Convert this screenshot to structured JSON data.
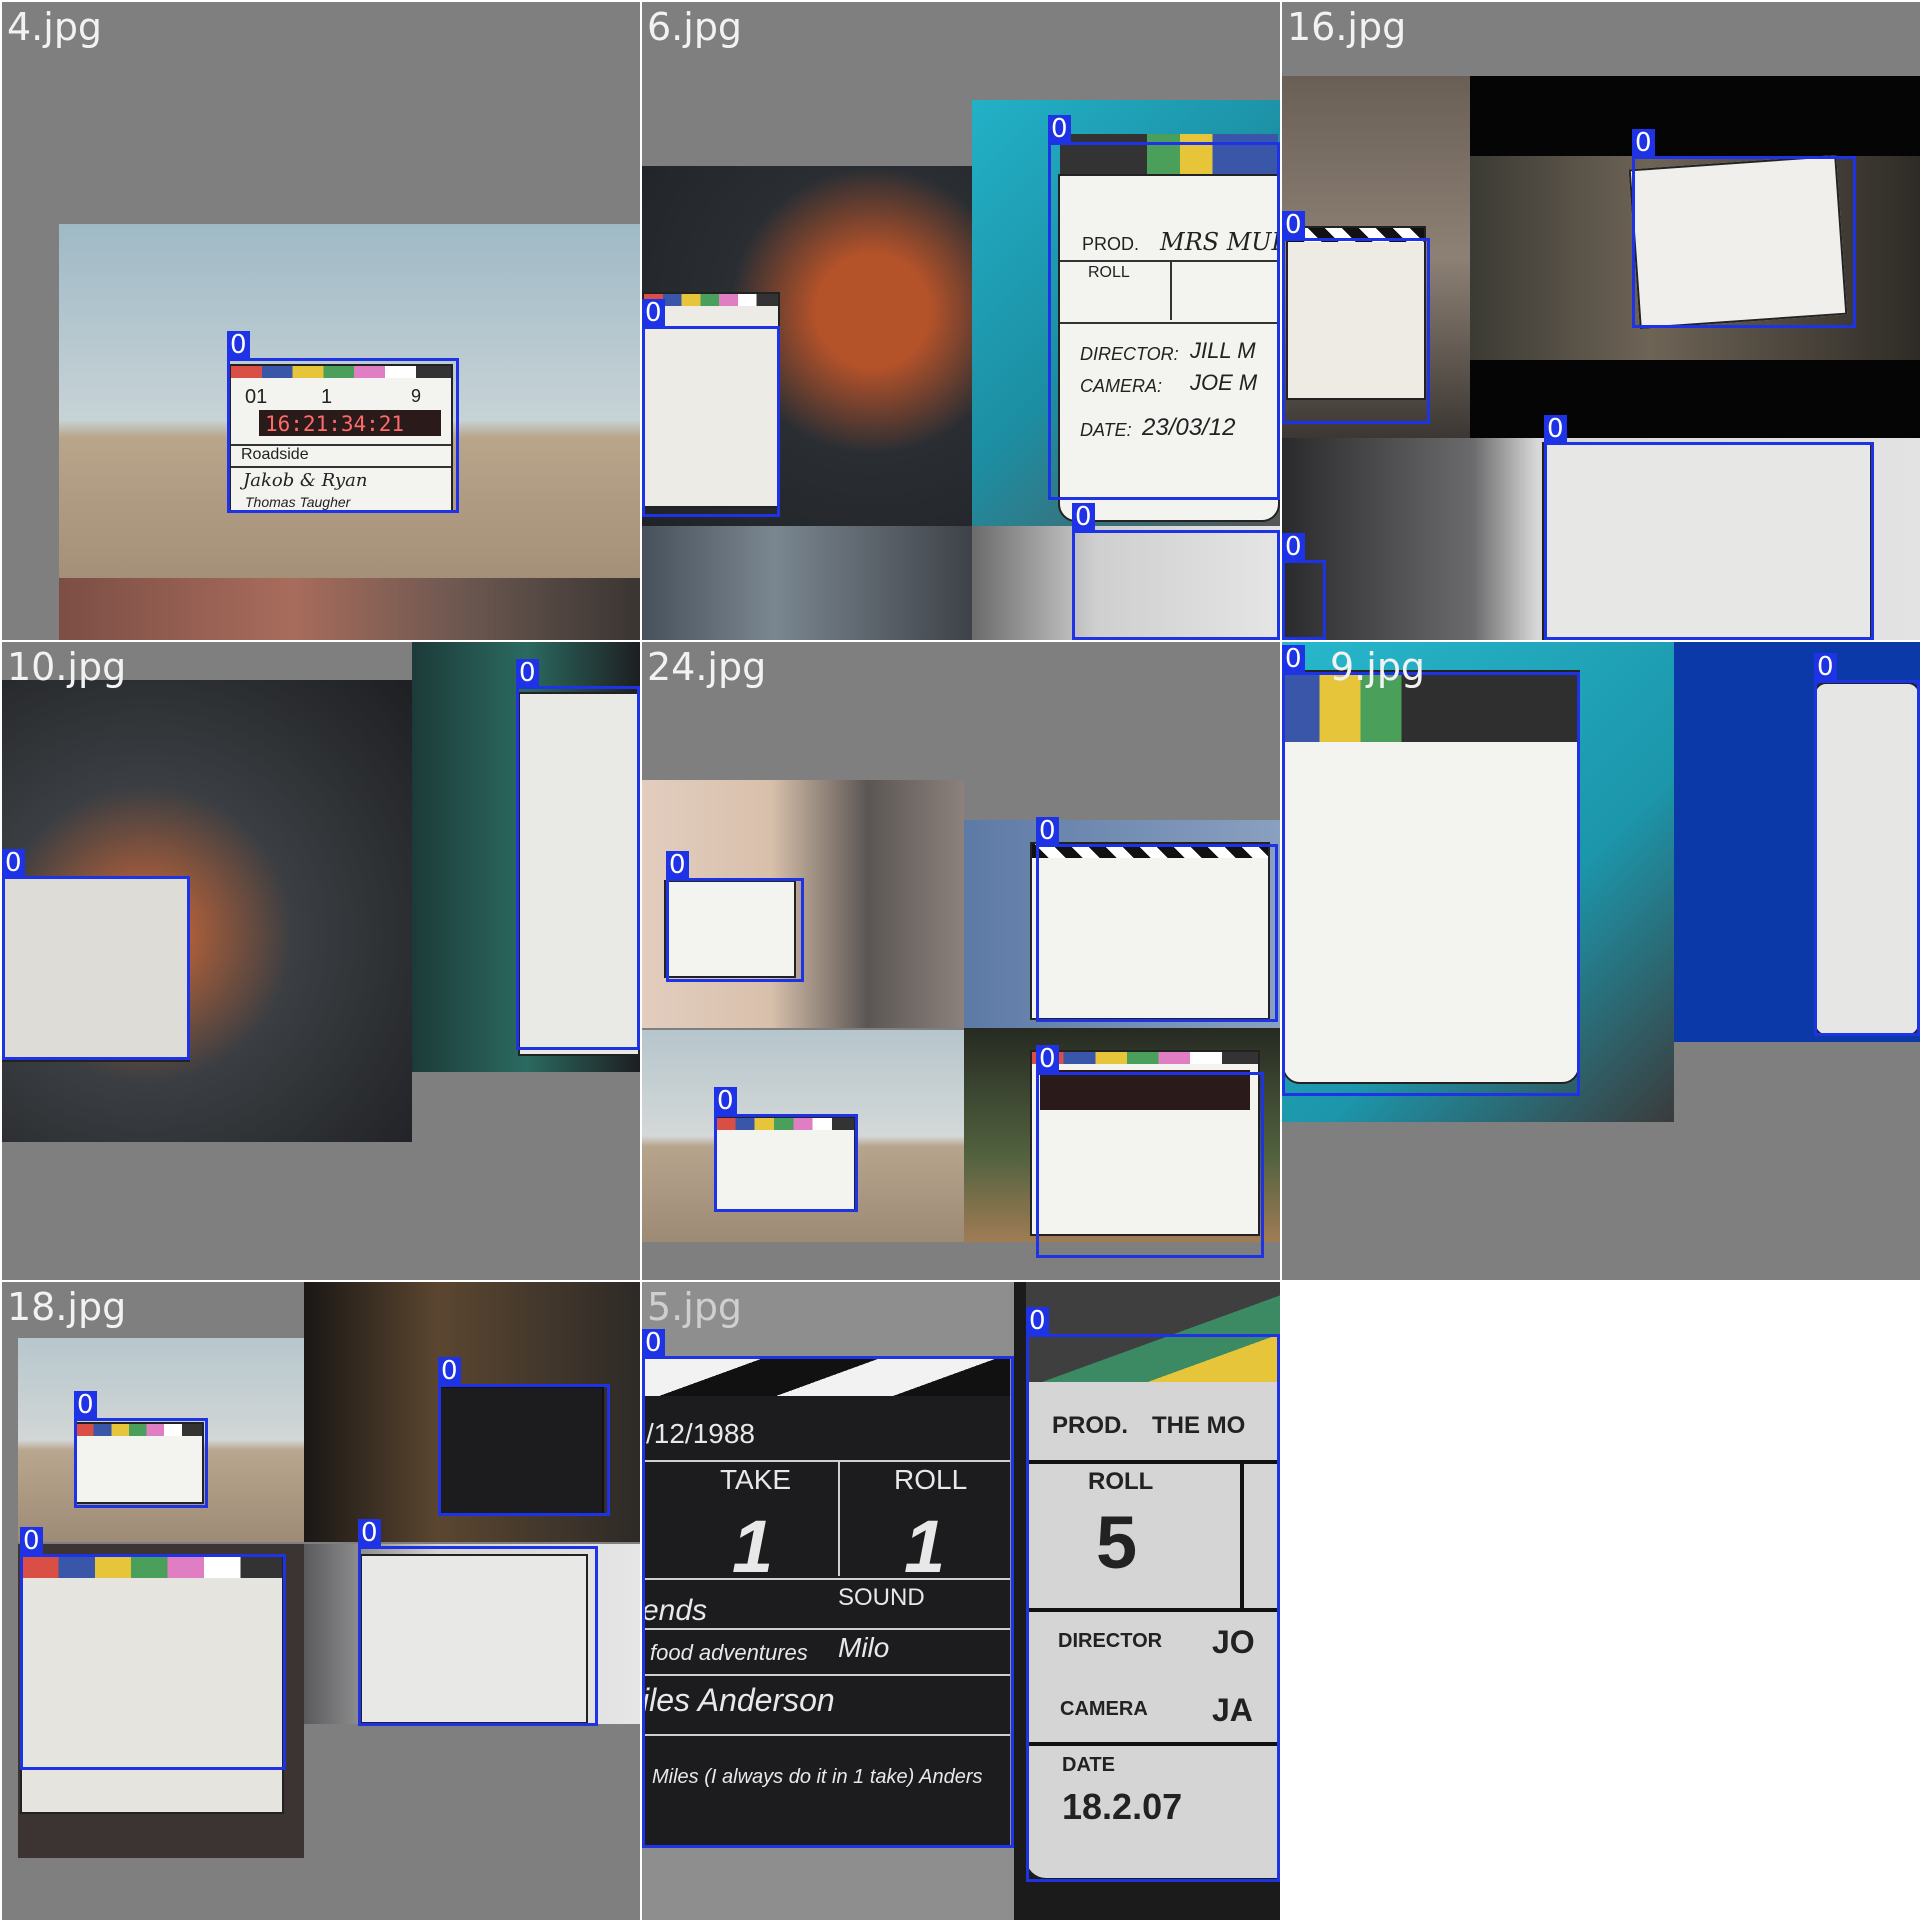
{
  "tiles": [
    {
      "label": "4.jpg"
    },
    {
      "label": "6.jpg"
    },
    {
      "label": "16.jpg"
    },
    {
      "label": "10.jpg"
    },
    {
      "label": "24.jpg"
    },
    {
      "label": "9.jpg"
    },
    {
      "label": "18.jpg"
    },
    {
      "label": "5.jpg"
    }
  ],
  "detection_class": "0",
  "box_color": "#1e32e6",
  "slates": {
    "t4": {
      "roll": "01",
      "scene": "1",
      "take": "9",
      "timecode": "16:21:34:21",
      "line1": "Roadside",
      "line2": "Jakob & Ryan",
      "line3": "Thomas Taugher"
    },
    "t6": {
      "prod": "PROD.",
      "prod_val": "MRS MULLER",
      "roll": "ROLL",
      "director": "DIRECTOR:",
      "director_val": "JILL M",
      "camera": "CAMERA:",
      "camera_val": "JOE M",
      "date": "DATE:",
      "date_val": "23/03/12"
    },
    "t5_left": {
      "date": "/12/1988",
      "take": "TAKE",
      "take_val": "1",
      "roll": "ROLL",
      "roll_val": "1",
      "ends": "ends",
      "sound": "SOUND",
      "food": "food adventures",
      "sound_val": "Milo",
      "name": "iles Anderson",
      "tagline": "Miles (I always do it in 1 take) Anders"
    },
    "t5_right": {
      "prod": "PROD.",
      "prod_val": "THE MO",
      "roll": "ROLL",
      "roll_val": "5",
      "director": "DIRECTOR",
      "director_val": "JO",
      "camera": "CAMERA",
      "camera_val": "JA",
      "date": "DATE",
      "date_val": "18.2.07"
    }
  }
}
